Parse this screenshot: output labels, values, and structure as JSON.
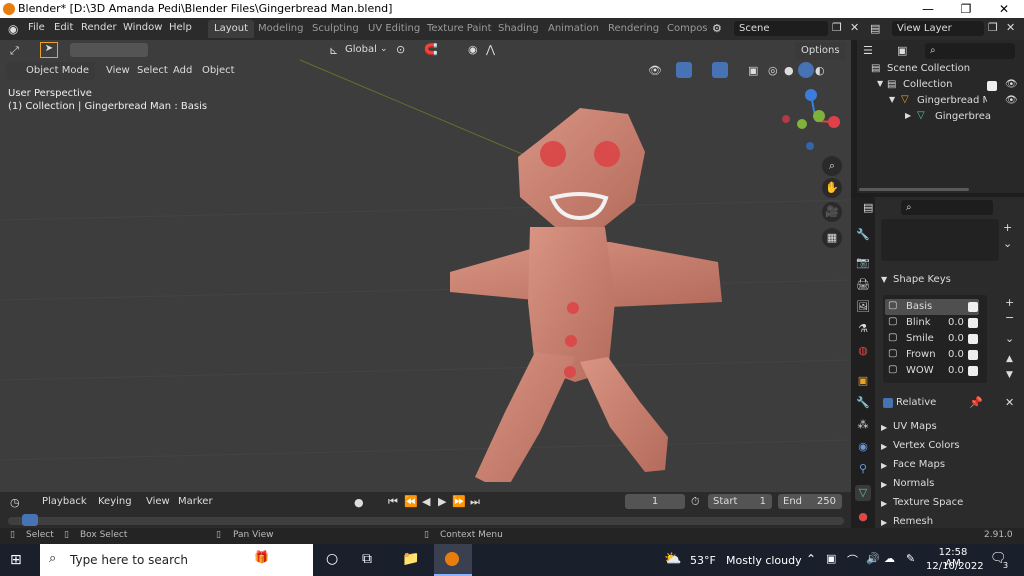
{
  "titlebar": {
    "title": "Blender* [D:\\3D Amanda Pedi\\Blender Files\\Gingerbread Man.blend]"
  },
  "menus": [
    "File",
    "Edit",
    "Render",
    "Window",
    "Help"
  ],
  "workspaces": [
    "Layout",
    "Modeling",
    "Sculpting",
    "UV Editing",
    "Texture Paint",
    "Shading",
    "Animation",
    "Rendering",
    "Compos"
  ],
  "active_workspace": "Layout",
  "scene_label": "Scene",
  "view_layer_label": "View Layer",
  "viewport": {
    "transform_orientation": "Global",
    "options_label": "Options",
    "mode": "Object Mode",
    "header_menus": [
      "View",
      "Select",
      "Add",
      "Object"
    ],
    "overlay_line1": "User Perspective",
    "overlay_line2": "(1) Collection | Gingerbread Man : Basis"
  },
  "outliner": {
    "scene_collection": "Scene Collection",
    "collection": "Collection",
    "object": "Gingerbread Ma",
    "mesh": "Gingerbread"
  },
  "properties": {
    "shape_keys_title": "Shape Keys",
    "shape_keys": [
      {
        "name": "Basis",
        "value": ""
      },
      {
        "name": "Blink",
        "value": "0.0"
      },
      {
        "name": "Smile",
        "value": "0.0"
      },
      {
        "name": "Frown",
        "value": "0.0"
      },
      {
        "name": "WOW",
        "value": "0.0"
      }
    ],
    "relative_label": "Relative",
    "sections": [
      "UV Maps",
      "Vertex Colors",
      "Face Maps",
      "Normals",
      "Texture Space",
      "Remesh"
    ]
  },
  "timeline": {
    "menus": [
      "Playback",
      "Keying",
      "View",
      "Marker"
    ],
    "current_frame": "1",
    "start_label": "Start",
    "start_value": "1",
    "end_label": "End",
    "end_value": "250"
  },
  "statusbar": {
    "select": "Select",
    "box_select": "Box Select",
    "pan_view": "Pan View",
    "context_menu": "Context Menu",
    "version": "2.91.0"
  },
  "taskbar": {
    "search_placeholder": "Type here to search",
    "weather_temp": "53°F",
    "weather_desc": "Mostly cloudy",
    "time": "12:58 AM",
    "date": "12/10/2022",
    "notifications": "3"
  },
  "colors": {
    "viewport_bg": "#3d3d3d",
    "gingerbread": "#c97f6e",
    "button_red": "#d94a4a",
    "accent_blue": "#4772b3",
    "x_axis": "#e0404a",
    "y_axis": "#7fb23b",
    "z_axis": "#3b7ddd"
  }
}
